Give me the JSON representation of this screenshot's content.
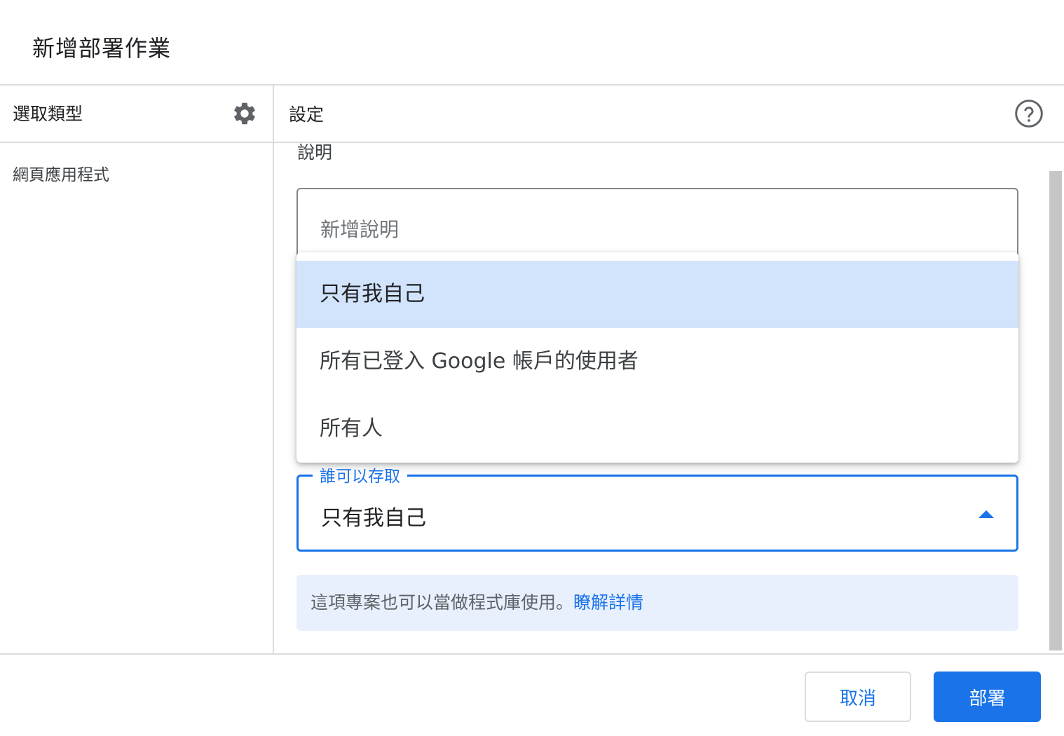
{
  "dialog": {
    "title": "新增部署作業"
  },
  "left_panel": {
    "header": "選取類型",
    "settings_icon": "gear-icon",
    "items": [
      {
        "label": "網頁應用程式"
      }
    ]
  },
  "right_panel": {
    "header": "設定",
    "help_icon": "help-circle-icon",
    "description": {
      "label": "說明",
      "placeholder": "新增說明",
      "value": ""
    },
    "access": {
      "label": "誰可以存取",
      "selected": "只有我自己",
      "expanded": true,
      "options": [
        {
          "label": "只有我自己",
          "selected": true
        },
        {
          "label": "所有已登入 Google 帳戶的使用者",
          "selected": false
        },
        {
          "label": "所有人",
          "selected": false
        }
      ]
    },
    "info": {
      "text": "這項專案也可以當做程式庫使用。",
      "link": "瞭解詳情"
    }
  },
  "footer": {
    "cancel_label": "取消",
    "deploy_label": "部署"
  },
  "colors": {
    "accent": "#1a73e8",
    "selected_option_bg": "#d2e3fc",
    "info_bg": "#e8f0fe",
    "divider": "#dadce0"
  }
}
